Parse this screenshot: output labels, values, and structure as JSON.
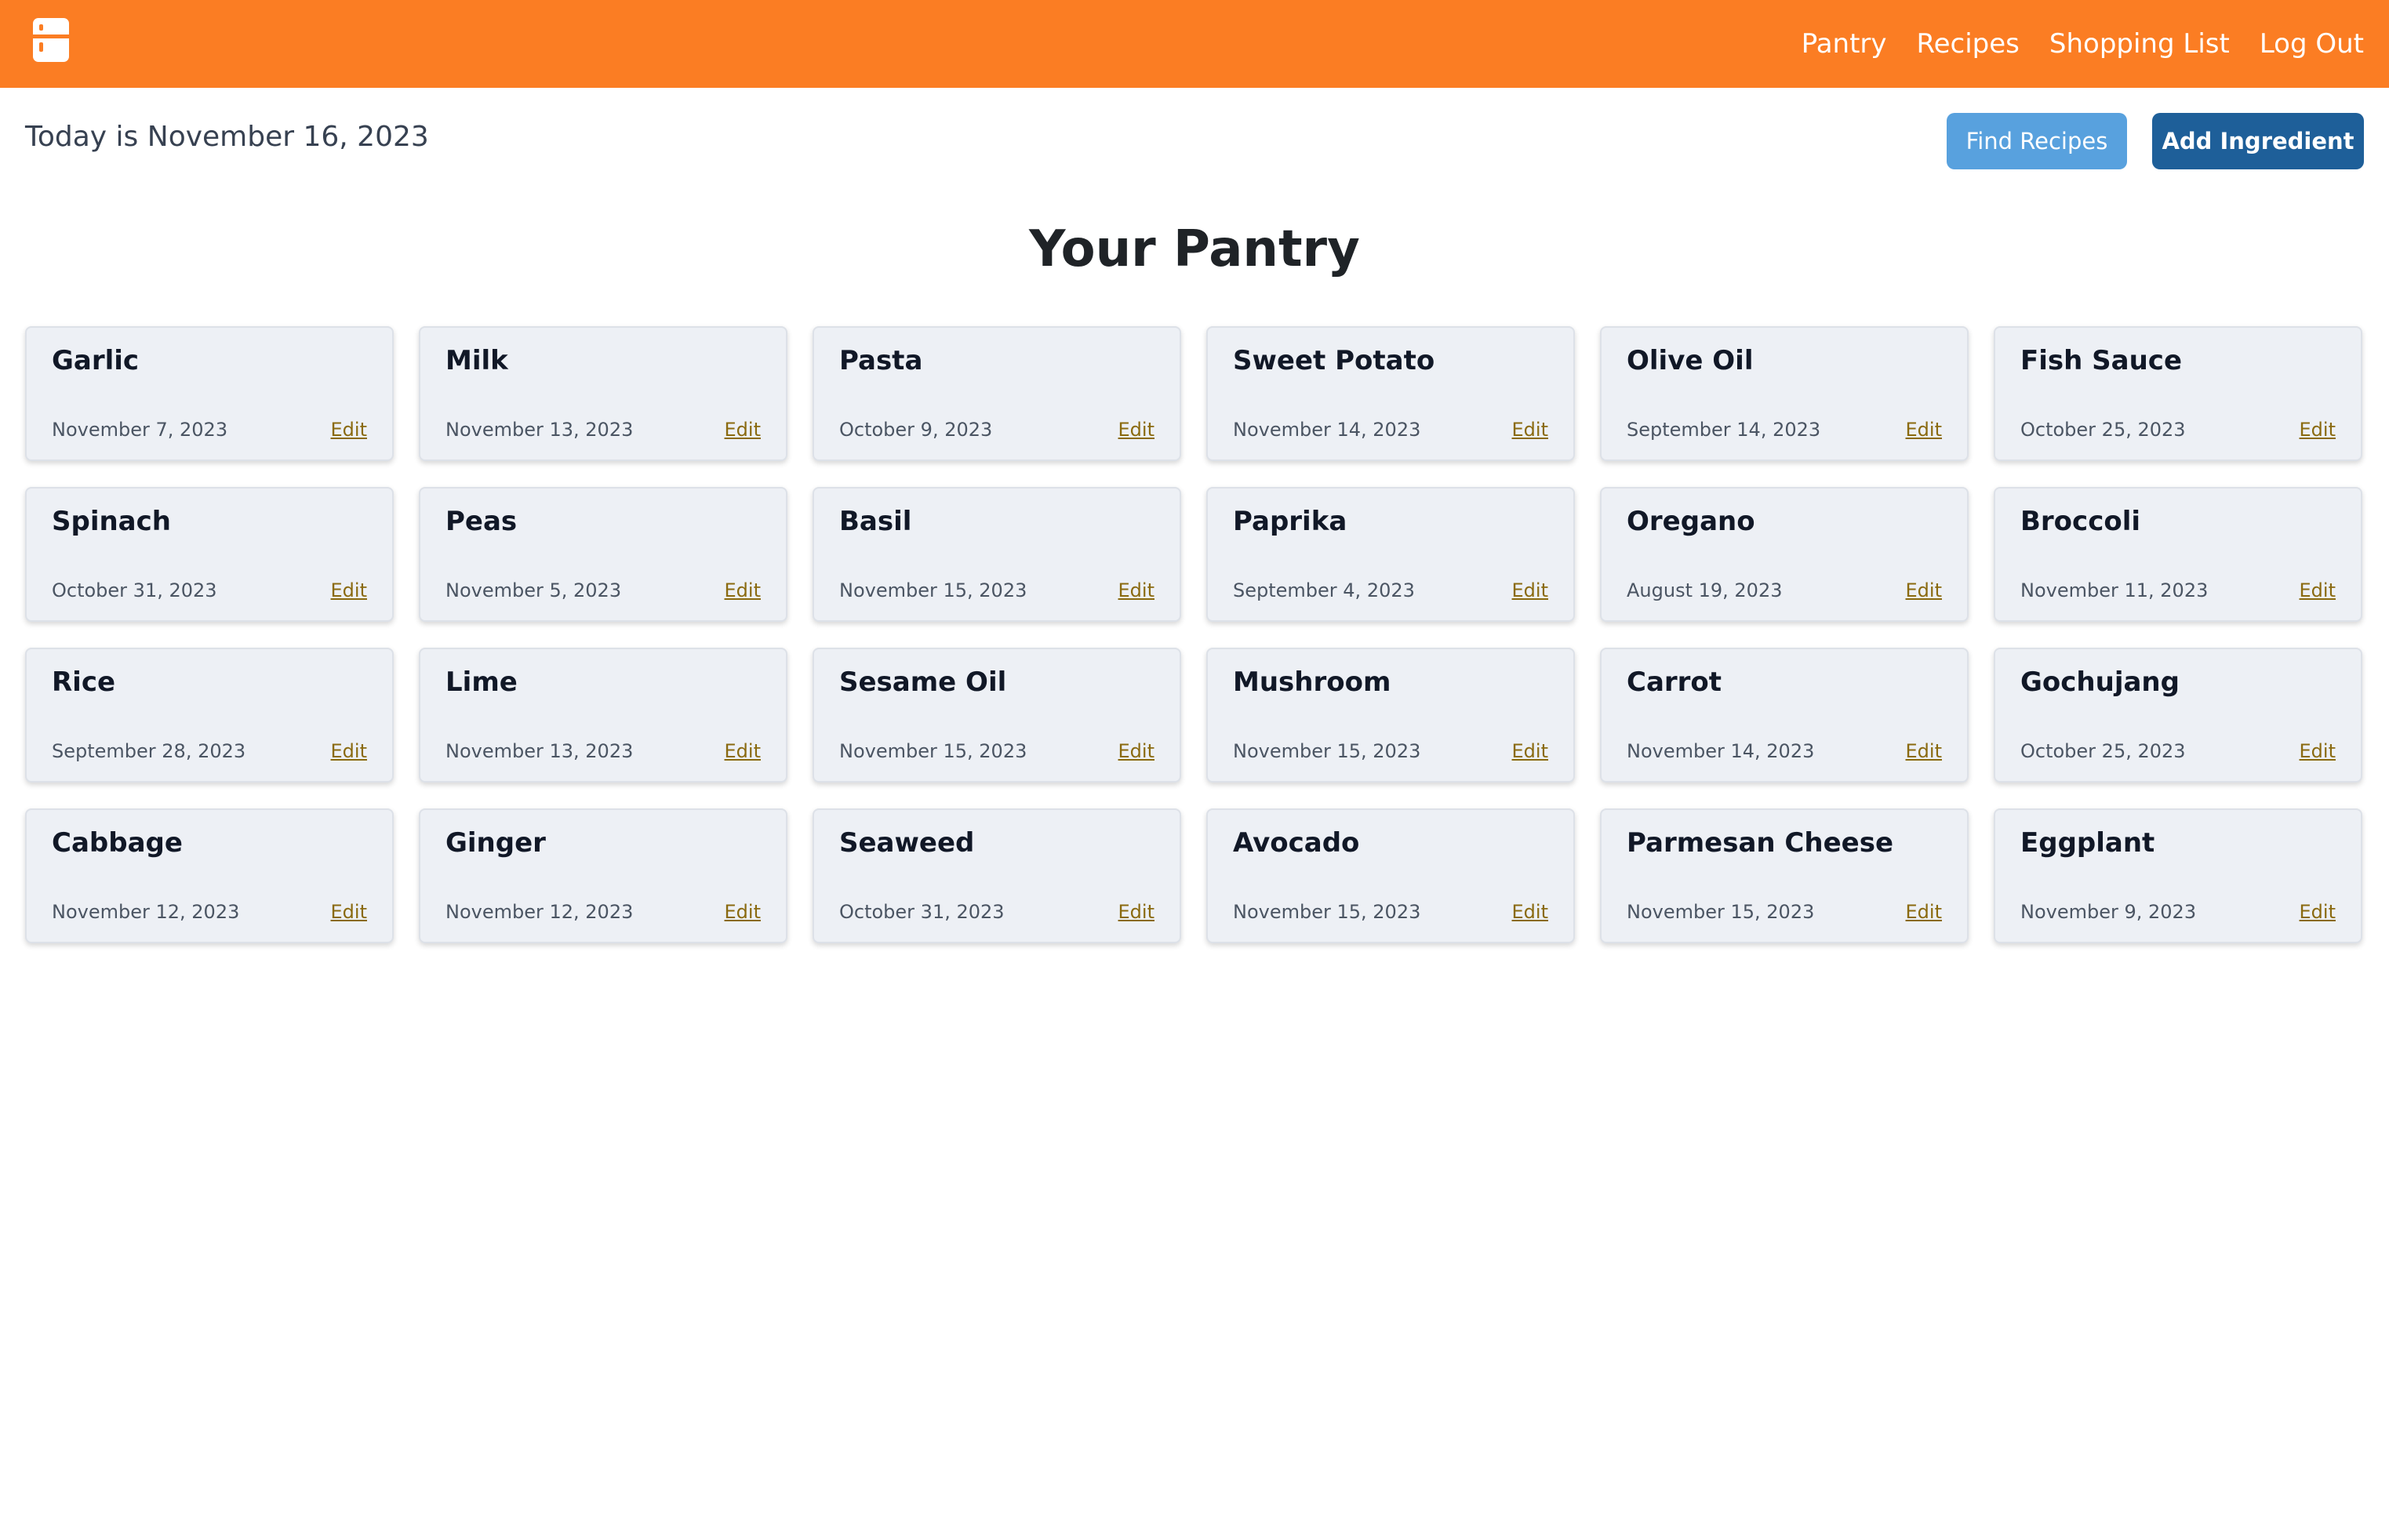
{
  "header": {
    "logo_icon": "fridge-icon",
    "nav": [
      "Pantry",
      "Recipes",
      "Shopping List",
      "Log Out"
    ]
  },
  "today_text": "Today is November 16, 2023",
  "actions": {
    "find_recipes": "Find Recipes",
    "add_ingredient": "Add Ingredient"
  },
  "page_title": "Your Pantry",
  "edit_label": "Edit",
  "colors": {
    "brand_orange": "#fb7d23",
    "find_button": "#58a1de",
    "add_button": "#1e5f99",
    "card_background": "#edf0f5",
    "edit_link": "#8a6a10"
  },
  "ingredients": [
    {
      "name": "Garlic",
      "date": "November 7, 2023"
    },
    {
      "name": "Milk",
      "date": "November 13, 2023"
    },
    {
      "name": "Pasta",
      "date": "October 9, 2023"
    },
    {
      "name": "Sweet Potato",
      "date": "November 14, 2023"
    },
    {
      "name": "Olive Oil",
      "date": "September 14, 2023"
    },
    {
      "name": "Fish Sauce",
      "date": "October 25, 2023"
    },
    {
      "name": "Spinach",
      "date": "October 31, 2023"
    },
    {
      "name": "Peas",
      "date": "November 5, 2023"
    },
    {
      "name": "Basil",
      "date": "November 15, 2023"
    },
    {
      "name": "Paprika",
      "date": "September 4, 2023"
    },
    {
      "name": "Oregano",
      "date": "August 19, 2023"
    },
    {
      "name": "Broccoli",
      "date": "November 11, 2023"
    },
    {
      "name": "Rice",
      "date": "September 28, 2023"
    },
    {
      "name": "Lime",
      "date": "November 13, 2023"
    },
    {
      "name": "Sesame Oil",
      "date": "November 15, 2023"
    },
    {
      "name": "Mushroom",
      "date": "November 15, 2023"
    },
    {
      "name": "Carrot",
      "date": "November 14, 2023"
    },
    {
      "name": "Gochujang",
      "date": "October 25, 2023"
    },
    {
      "name": "Cabbage",
      "date": "November 12, 2023"
    },
    {
      "name": "Ginger",
      "date": "November 12, 2023"
    },
    {
      "name": "Seaweed",
      "date": "October 31, 2023"
    },
    {
      "name": "Avocado",
      "date": "November 15, 2023"
    },
    {
      "name": "Parmesan Cheese",
      "date": "November 15, 2023"
    },
    {
      "name": "Eggplant",
      "date": "November 9, 2023"
    }
  ]
}
